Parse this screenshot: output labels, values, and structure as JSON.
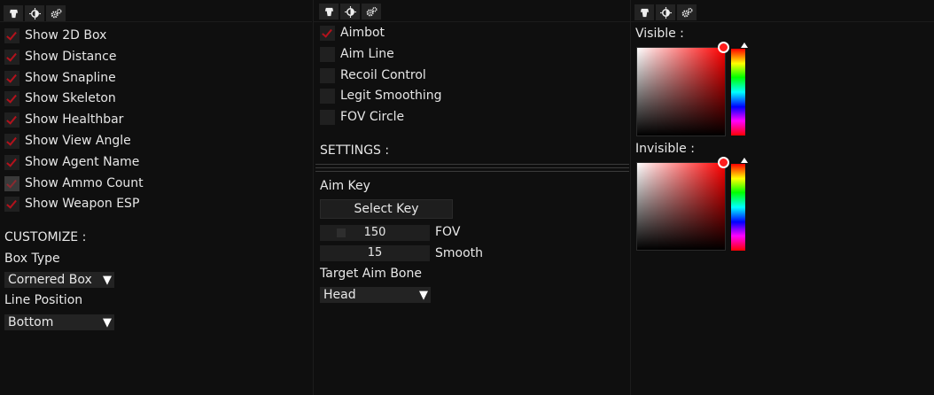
{
  "esp_panel": {
    "tabs": [
      "aim-hand-icon",
      "sun-icon",
      "gears-icon"
    ],
    "checkboxes": [
      {
        "label": "Show 2D Box",
        "checked": true
      },
      {
        "label": "Show Distance",
        "checked": true
      },
      {
        "label": "Show Snapline",
        "checked": true
      },
      {
        "label": "Show Skeleton",
        "checked": true
      },
      {
        "label": "Show Healthbar",
        "checked": true
      },
      {
        "label": "Show View Angle",
        "checked": true
      },
      {
        "label": "Show Agent Name",
        "checked": true
      },
      {
        "label": "Show Ammo Count",
        "checked": true
      },
      {
        "label": "Show Weapon ESP",
        "checked": true
      }
    ],
    "customize_header": "CUSTOMIZE :",
    "box_type_label": "Box Type",
    "box_type_value": "Cornered Box",
    "line_position_label": "Line Position",
    "line_position_value": "Bottom"
  },
  "aim_panel": {
    "tabs": [
      "aim-hand-icon",
      "sun-icon",
      "gears-icon"
    ],
    "checkboxes": [
      {
        "label": "Aimbot",
        "checked": true
      },
      {
        "label": "Aim Line",
        "checked": false
      },
      {
        "label": "Recoil Control",
        "checked": false
      },
      {
        "label": "Legit Smoothing",
        "checked": false
      },
      {
        "label": "FOV Circle",
        "checked": false
      }
    ],
    "settings_header": "SETTINGS :",
    "aim_key_label": "Aim Key",
    "select_key_button": "Select Key",
    "fov": {
      "value": "150",
      "label": "FOV"
    },
    "smooth": {
      "value": "15",
      "label": "Smooth"
    },
    "target_bone_label": "Target Aim Bone",
    "target_bone_value": "Head"
  },
  "color_panel": {
    "tabs": [
      "aim-hand-icon",
      "sun-icon",
      "gears-icon"
    ],
    "visible_label": "Visible :",
    "invisible_label": "Invisible :",
    "visible_color": "#ff0000",
    "invisible_color": "#ff0000"
  },
  "colors": {
    "accent": "#b3121c",
    "background": "#0f0f0f",
    "widget": "#232323"
  }
}
